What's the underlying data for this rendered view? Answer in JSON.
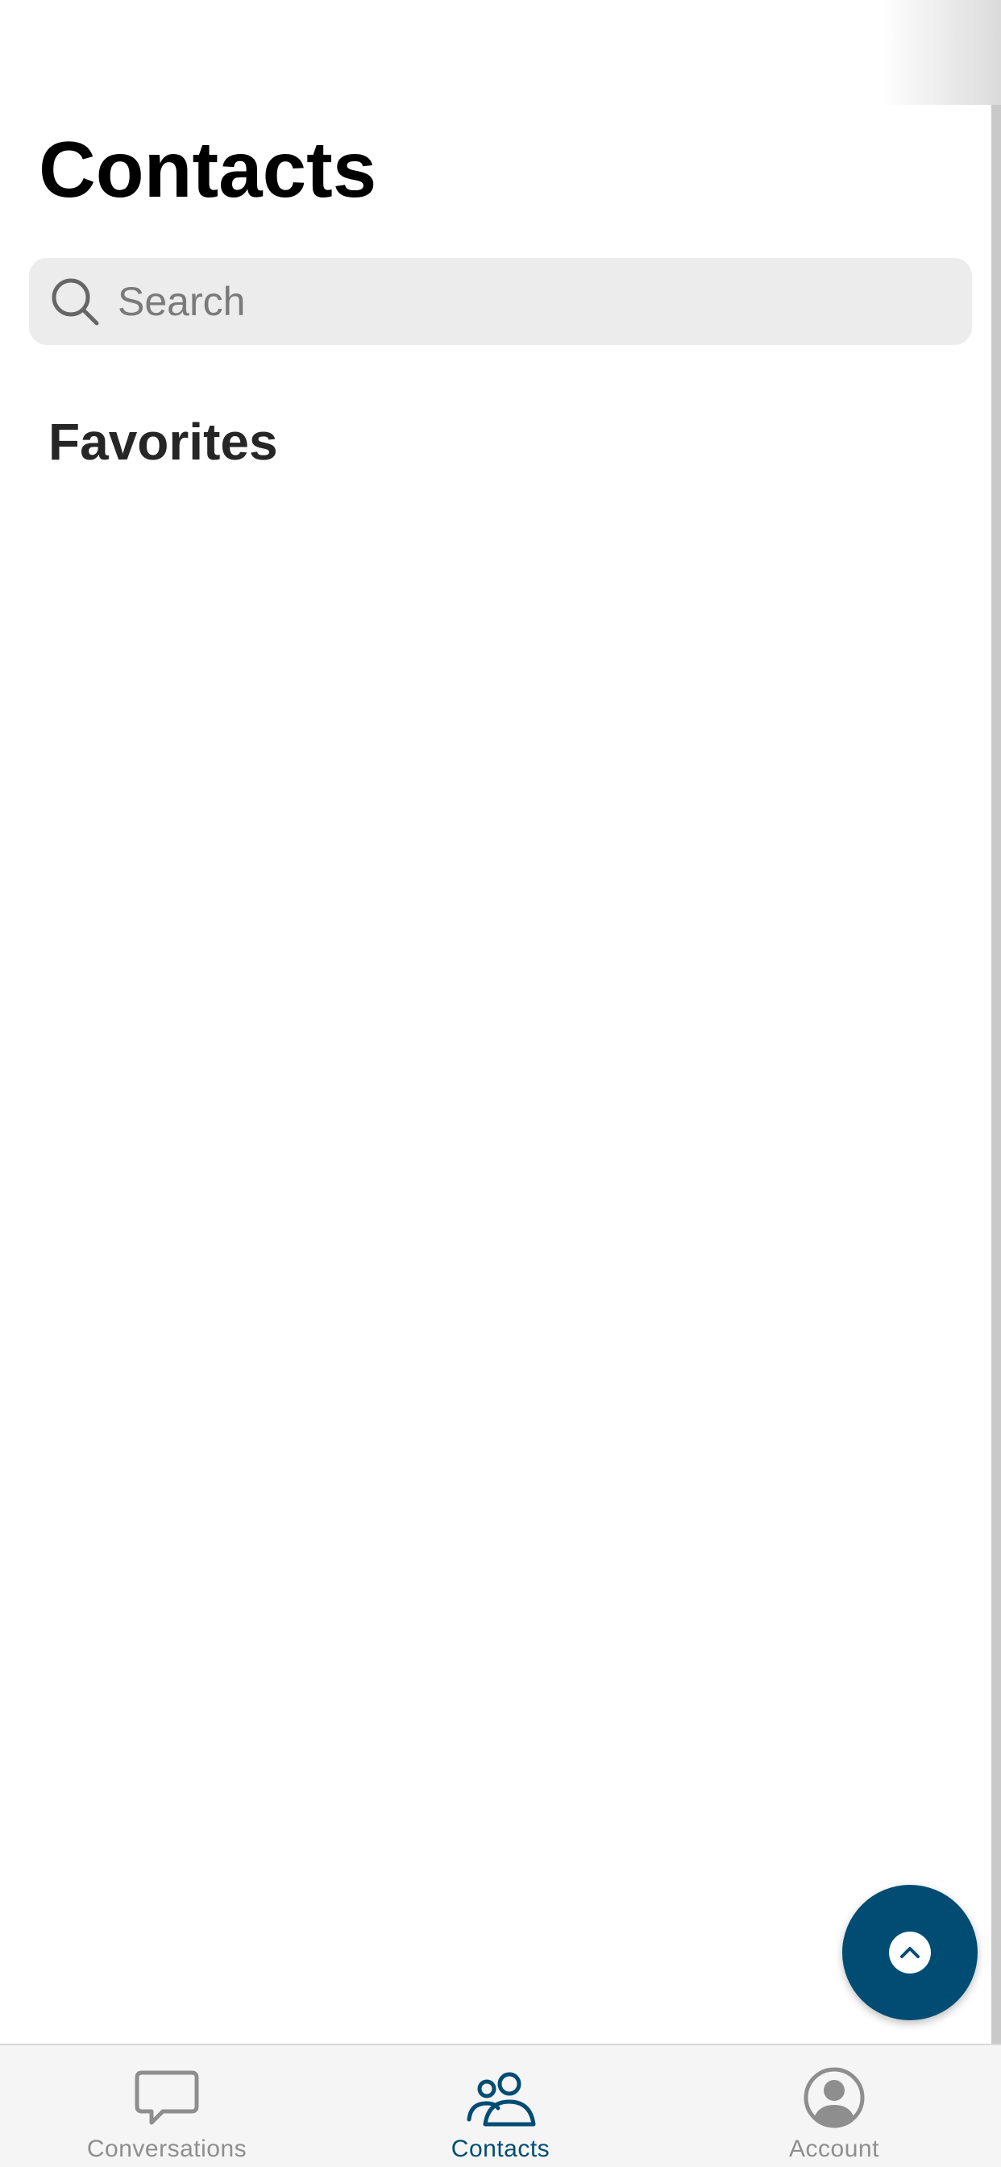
{
  "header": {
    "title": "Contacts"
  },
  "search": {
    "placeholder": "Search",
    "value": ""
  },
  "sections": {
    "favorites_label": "Favorites"
  },
  "tabs": [
    {
      "label": "Conversations",
      "icon": "chat-bubble-icon",
      "active": false
    },
    {
      "label": "Contacts",
      "icon": "people-icon",
      "active": true
    },
    {
      "label": "Account",
      "icon": "user-circle-icon",
      "active": false
    }
  ],
  "fab": {
    "icon": "chevron-up-icon"
  },
  "colors": {
    "accent": "#014c73",
    "inactive": "#8e8e8e",
    "search_bg": "#ececec",
    "tabbar_bg": "#f5f5f5"
  }
}
